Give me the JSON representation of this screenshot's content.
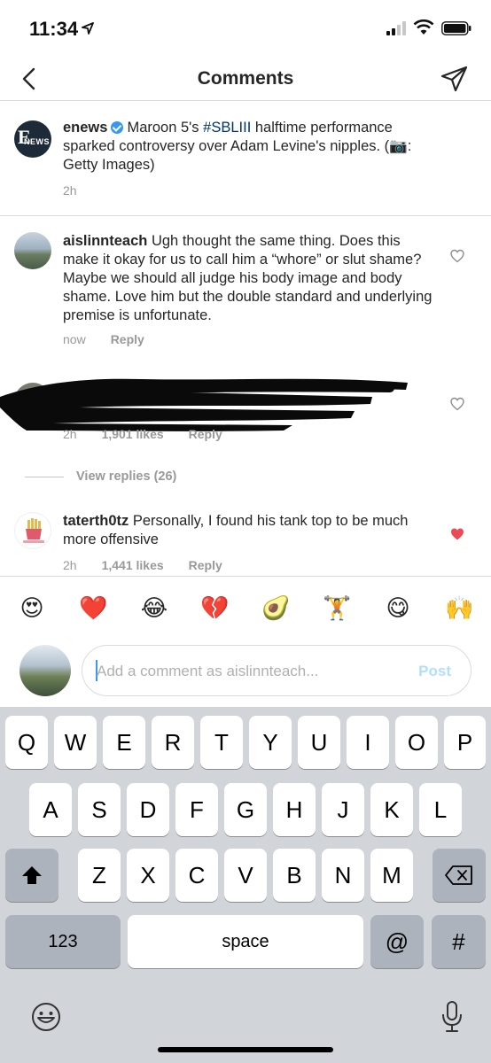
{
  "status": {
    "time": "11:34"
  },
  "nav": {
    "title": "Comments"
  },
  "caption": {
    "avatar_text": "E",
    "avatar_sub": "NEWS",
    "username": "enews",
    "text_before_tag": "Maroon 5's ",
    "tag": "#SBLIII",
    "text_after_tag": " halftime performance sparked controversy over Adam Levine's nipples. (📷: Getty Images)",
    "time": "2h"
  },
  "comments": [
    {
      "username": "aislinnteach",
      "text": "Ugh thought the same thing. Does this make it okay for us to call him a “whore” or slut shame? Maybe we should all judge his body image and body shame. Love him but the double standard and underlying premise is unfortunate.",
      "time": "now",
      "reply": "Reply"
    },
    {
      "username": "",
      "text": "",
      "time": "2h",
      "likes": "1,901 likes",
      "reply": "Reply"
    },
    {
      "username": "taterth0tz",
      "text": "Personally, I found his tank top to be much more offensive",
      "time": "2h",
      "likes": "1,441 likes",
      "reply": "Reply",
      "liked": true
    }
  ],
  "view_replies": "View replies (26)",
  "emoji_bar": [
    "😍",
    "❤️",
    "😂",
    "💔",
    "🥑",
    "🏋",
    "😋",
    "🙌"
  ],
  "input": {
    "placeholder": "Add a comment as aislinnteach...",
    "post": "Post"
  },
  "keyboard": {
    "row1": [
      "Q",
      "W",
      "E",
      "R",
      "T",
      "Y",
      "U",
      "I",
      "O",
      "P"
    ],
    "row2": [
      "A",
      "S",
      "D",
      "F",
      "G",
      "H",
      "J",
      "K",
      "L"
    ],
    "row3": [
      "Z",
      "X",
      "C",
      "V",
      "B",
      "N",
      "M"
    ],
    "numbers": "123",
    "space": "space",
    "at": "@",
    "hash": "#"
  },
  "colors": {
    "accent": "#3897f0",
    "heart_liked": "#ed4956",
    "tag": "#003569"
  }
}
